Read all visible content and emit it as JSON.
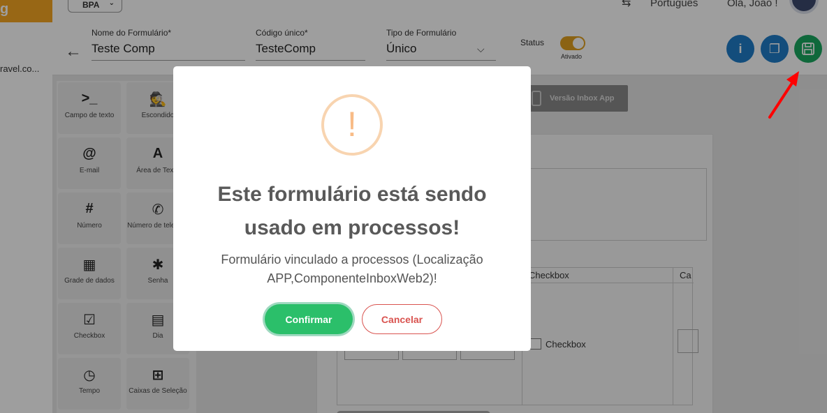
{
  "top": {
    "company": "BPA",
    "language": "Português",
    "greeting": "Olá, João !"
  },
  "sidebar": {
    "email_truncated": "ravel.co..."
  },
  "form_header": {
    "name_label": "Nome do Formulário*",
    "name_value": "Teste Comp",
    "code_label": "Código único*",
    "code_value": "TesteComp",
    "type_label": "Tipo de Formulário",
    "type_value": "Único",
    "status_label": "Status",
    "status_value": "Ativado"
  },
  "palette": [
    {
      "icon": "terminal-icon",
      "glyph": ">_",
      "label": "Campo de texto"
    },
    {
      "icon": "spy-icon",
      "glyph": "🕵",
      "label": "Escondido"
    },
    {
      "icon": "at-icon",
      "glyph": "@",
      "label": "E-mail"
    },
    {
      "icon": "font-icon",
      "glyph": "A",
      "label": "Área de Texto"
    },
    {
      "icon": "hash-icon",
      "glyph": "#",
      "label": "Número"
    },
    {
      "icon": "phone-icon",
      "glyph": "✆",
      "label": "Número de telefone"
    },
    {
      "icon": "grid-icon",
      "glyph": "▦",
      "label": "Grade de dados"
    },
    {
      "icon": "asterisk-icon",
      "glyph": "✱",
      "label": "Senha"
    },
    {
      "icon": "checkbox-icon",
      "glyph": "☑",
      "label": "Checkbox"
    },
    {
      "icon": "calendar-icon",
      "glyph": "▤",
      "label": "Dia"
    },
    {
      "icon": "clock-icon",
      "glyph": "◷",
      "label": "Tempo"
    },
    {
      "icon": "plus-square-icon",
      "glyph": "⊞",
      "label": "Caixas de Seleção"
    }
  ],
  "workspace": {
    "inbox_button": "Versão Inbox App",
    "grid_col_checkbox": "Checkbox",
    "grid_col_next": "Ca",
    "grid_checkbox_label": "Checkbox"
  },
  "modal": {
    "title": "Este formulário está sendo usado em processos!",
    "text": "Formulário vinculado a processos (Localização APP,ComponenteInboxWeb2)!",
    "confirm": "Confirmar",
    "cancel": "Cancelar"
  },
  "colors": {
    "accent": "#f5a623",
    "info_button": "#1f7dc8",
    "save_button": "#19a860",
    "confirm": "#2bbf6a",
    "cancel": "#d9534f",
    "warning": "#f8bb86",
    "annotation_arrow": "#ff0000"
  }
}
